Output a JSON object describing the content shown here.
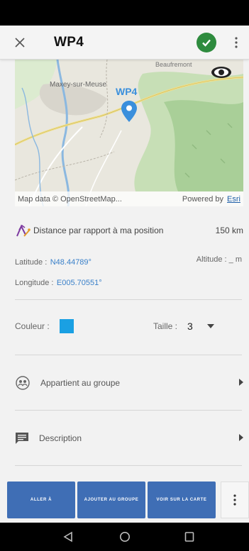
{
  "header": {
    "title": "WP4"
  },
  "map": {
    "waypoint_label": "WP4",
    "town_label": "Maxey-sur-Meuse",
    "top_label": "Beaufremont",
    "attribution": "Map data © OpenStreetMap...",
    "powered_by": "Powered by",
    "esri": "Esri"
  },
  "distance": {
    "label": "Distance par rapport à ma position",
    "value": "150 km"
  },
  "coords": {
    "latitude_label": "Latitude :",
    "latitude_value": "N48.44789°",
    "longitude_label": "Longitude :",
    "longitude_value": "E005.70551°",
    "altitude_label": "Altitude : _ m"
  },
  "style": {
    "color_label": "Couleur :",
    "color_value": "#1aa0e3",
    "size_label": "Taille :",
    "size_value": "3"
  },
  "group": {
    "label": "Appartient au groupe"
  },
  "description": {
    "label": "Description"
  },
  "actions": {
    "go_to": "ALLER À",
    "add_to_group": "AJOUTER AU GROUPE",
    "view_on_map": "VOIR SUR LA CARTE"
  },
  "colors": {
    "accent": "#3f6eb5",
    "confirm": "#2e8b3e",
    "pin": "#3a8fdc"
  }
}
